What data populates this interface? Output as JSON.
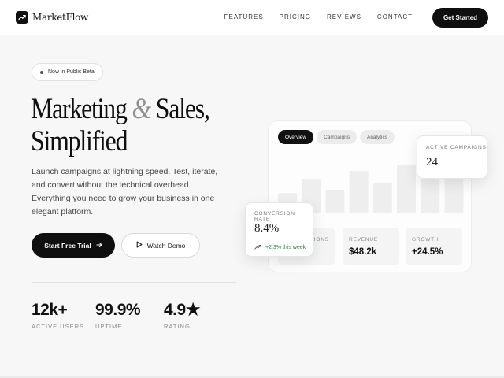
{
  "brand": {
    "name": "MarketFlow",
    "logo_icon": "trend-up-icon"
  },
  "nav": {
    "links": [
      "FEATURES",
      "PRICING",
      "REVIEWS",
      "CONTACT"
    ],
    "cta_label": "Get Started"
  },
  "hero": {
    "badge": "Now in Public Beta",
    "headline": {
      "word1": "Marketing",
      "amp": "&",
      "word2": "Sales,",
      "line2": "Simplified"
    },
    "description": "Launch campaigns at lightning speed. Test, iterate, and convert without the technical overhead. Everything you need to grow your business in one elegant platform.",
    "primary_cta": "Start Free Trial",
    "secondary_cta": "Watch Demo"
  },
  "stats": [
    {
      "value": "12k+",
      "label": "ACTIVE USERS"
    },
    {
      "value": "99.9%",
      "label": "UPTIME"
    },
    {
      "value": "4.9★",
      "label": "RATING"
    }
  ],
  "dashboard": {
    "tabs": [
      "Overview",
      "Campaigns",
      "Analytics"
    ],
    "active_tab": "Overview",
    "bar_levels": [
      0.26,
      0.44,
      0.3,
      0.54,
      0.38,
      0.62,
      0.54,
      0.48
    ],
    "bar_color": "#eeeeee",
    "kpis": [
      {
        "label": "CONVERSIONS",
        "value": ""
      },
      {
        "label": "REVENUE",
        "value": "$48.2k"
      },
      {
        "label": "GROWTH",
        "value": "+24.5%"
      }
    ]
  },
  "floating_cards": {
    "active_campaigns": {
      "label": "ACTIVE CAMPAIGNS",
      "value": "24"
    },
    "conversion_rate": {
      "label": "CONVERSION RATE",
      "value": "8.4%",
      "trend": "+2.3% this week",
      "trend_color": "#2f8a3e"
    }
  },
  "colors": {
    "accent": "#0f0f0f",
    "background": "#f7f7f7",
    "muted": "#8c8c8c"
  }
}
